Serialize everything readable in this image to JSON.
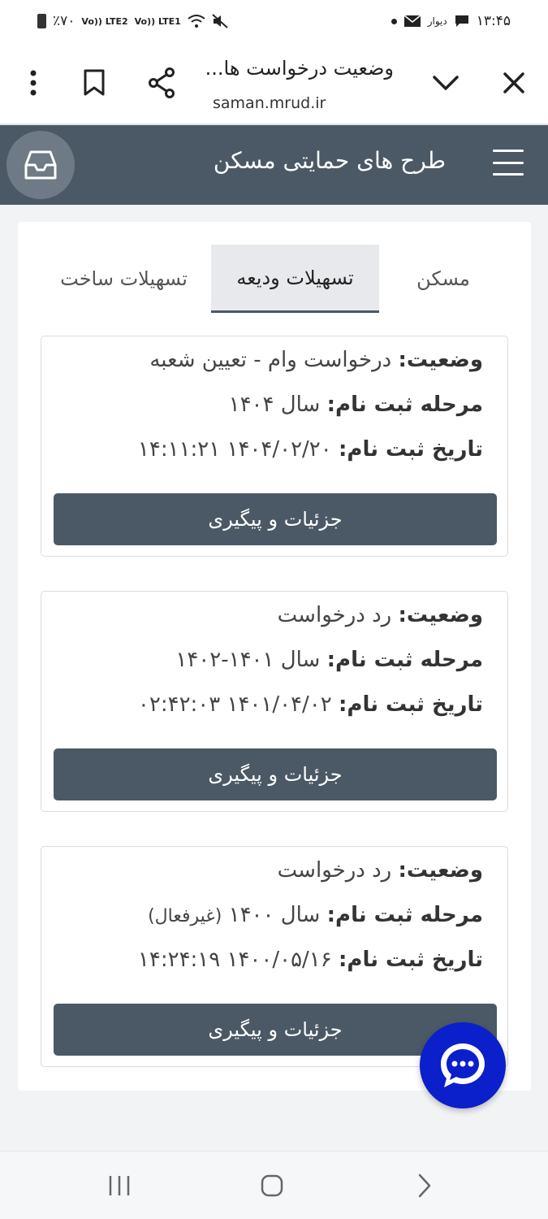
{
  "status_bar": {
    "battery_text": "٪۷۰",
    "signal_1": "Vo)) LTE2",
    "signal_2": "Vo)) LTE1",
    "divar_label": "دیوار",
    "time": "۱۳:۴۵"
  },
  "browser": {
    "page_title": "وضعیت درخواست ها...",
    "host": "saman.mrud.ir"
  },
  "header": {
    "title": "طرح های حمایتی مسکن"
  },
  "tabs": [
    {
      "label": "مسکن",
      "active": false
    },
    {
      "label": "تسهیلات ودیعه",
      "active": true
    },
    {
      "label": "تسهیلات ساخت",
      "active": false
    }
  ],
  "labels": {
    "status": "وضعیت:",
    "stage": "مرحله ثبت نام:",
    "date": "تاریخ ثبت نام:"
  },
  "requests": [
    {
      "status": "درخواست وام - تعیین شعبه",
      "stage": "سال ۱۴۰۴",
      "stage_note": "",
      "date": "۱۴۰۴/۰۲/۲۰ ۱۴:۱۱:۲۱",
      "button": "جزئیات و پیگیری"
    },
    {
      "status": "رد درخواست",
      "stage": "سال ۱۴۰۱-۱۴۰۲",
      "stage_note": "",
      "date": "۱۴۰۱/۰۴/۰۲ ۰۲:۴۲:۰۳",
      "button": "جزئیات و پیگیری"
    },
    {
      "status": "رد درخواست",
      "stage": "سال ۱۴۰۰",
      "stage_note": "(غیرفعال)",
      "date": "۱۴۰۰/۰۵/۱۶ ۱۴:۲۴:۱۹",
      "button": "جزئیات و پیگیری"
    }
  ],
  "icons": {
    "menu": "more-vert-icon",
    "bookmark": "bookmark-icon",
    "share": "share-icon",
    "collapse": "chevron-down-icon",
    "close": "close-icon",
    "inbox": "inbox-icon",
    "hamburger": "hamburger-menu-icon",
    "chat": "chat-icon"
  },
  "colors": {
    "header_bg": "#4a5965",
    "button_bg": "#4a5965",
    "chat_fab": "#0b1fcb"
  }
}
